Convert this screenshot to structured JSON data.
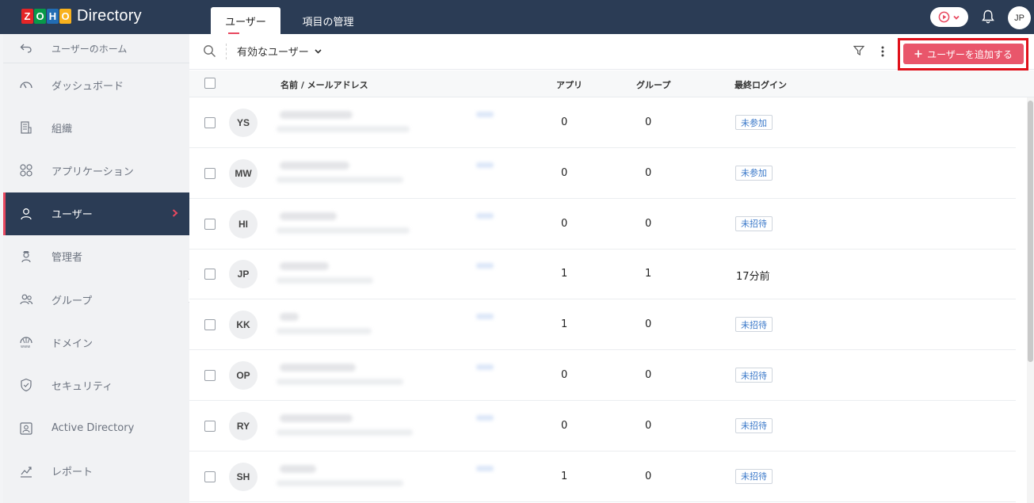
{
  "app": {
    "logo_letters": [
      {
        "ch": "Z",
        "color": "#e42527"
      },
      {
        "ch": "O",
        "color": "#089949"
      },
      {
        "ch": "H",
        "color": "#226db4"
      },
      {
        "ch": "O",
        "color": "#f9b21d"
      }
    ],
    "product_name": "Directory",
    "tabs": [
      {
        "label": "ユーザー",
        "active": true
      },
      {
        "label": "項目の管理",
        "active": false
      }
    ],
    "user_initials": "JP",
    "colors": {
      "header_bg": "#2b3c55",
      "accent": "#e9566b",
      "highlight_frame": "#e0101a"
    }
  },
  "sidebar": {
    "home_label": "ユーザーのホーム",
    "items": [
      {
        "label": "ダッシュボード",
        "icon": "dashboard-gauge-icon",
        "active": false
      },
      {
        "label": "組織",
        "icon": "organization-building-icon",
        "active": false
      },
      {
        "label": "アプリケーション",
        "icon": "applications-grid-icon",
        "active": false
      },
      {
        "label": "ユーザー",
        "icon": "user-icon",
        "active": true
      },
      {
        "label": "管理者",
        "icon": "admin-icon",
        "active": false
      },
      {
        "label": "グループ",
        "icon": "group-icon",
        "active": false
      },
      {
        "label": "ドメイン",
        "icon": "domain-www-icon",
        "active": false
      },
      {
        "label": "セキュリティ",
        "icon": "shield-check-icon",
        "active": false
      },
      {
        "label": "Active Directory",
        "icon": "active-directory-icon",
        "active": false
      },
      {
        "label": "レポート",
        "icon": "report-chart-icon",
        "active": false
      }
    ]
  },
  "toolbar": {
    "view_label": "有効なユーザー",
    "add_button_label": "ユーザーを追加する"
  },
  "table": {
    "columns": {
      "name": "名前 / メールアドレス",
      "apps": "アプリ",
      "groups": "グループ",
      "last_login": "最終ログイン"
    },
    "rows": [
      {
        "initials": "YS",
        "apps": "0",
        "groups": "0",
        "status": "未参加",
        "is_badge": true
      },
      {
        "initials": "MW",
        "apps": "0",
        "groups": "0",
        "status": "未参加",
        "is_badge": true
      },
      {
        "initials": "HI",
        "apps": "0",
        "groups": "0",
        "status": "未招待",
        "is_badge": true
      },
      {
        "initials": "JP",
        "apps": "1",
        "groups": "1",
        "status": "17分前",
        "is_badge": false
      },
      {
        "initials": "KK",
        "apps": "1",
        "groups": "0",
        "status": "未招待",
        "is_badge": true
      },
      {
        "initials": "OP",
        "apps": "0",
        "groups": "0",
        "status": "未招待",
        "is_badge": true
      },
      {
        "initials": "RY",
        "apps": "0",
        "groups": "0",
        "status": "未招待",
        "is_badge": true
      },
      {
        "initials": "SH",
        "apps": "1",
        "groups": "0",
        "status": "未招待",
        "is_badge": true
      }
    ]
  }
}
